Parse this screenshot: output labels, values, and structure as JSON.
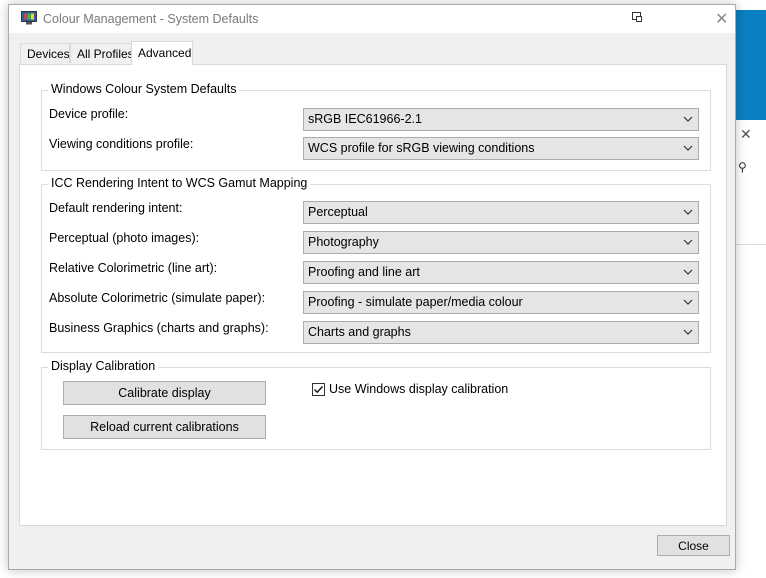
{
  "window": {
    "title": "Colour Management - System Defaults",
    "close_glyph": "✕"
  },
  "tabs": [
    {
      "label": "Devices"
    },
    {
      "label": "All Profiles"
    },
    {
      "label": "Advanced",
      "active": true
    }
  ],
  "wcs_defaults": {
    "title": "Windows Colour System Defaults",
    "rows": [
      {
        "label": "Device profile:",
        "value": "sRGB IEC61966-2.1"
      },
      {
        "label": "Viewing conditions profile:",
        "value": "WCS profile for sRGB viewing conditions"
      }
    ]
  },
  "icc_mapping": {
    "title": "ICC Rendering Intent to WCS Gamut Mapping",
    "rows": [
      {
        "label": "Default rendering intent:",
        "value": "Perceptual"
      },
      {
        "label": "Perceptual (photo images):",
        "value": "Photography"
      },
      {
        "label": "Relative Colorimetric (line art):",
        "value": "Proofing and line art"
      },
      {
        "label": "Absolute Colorimetric (simulate paper):",
        "value": "Proofing - simulate paper/media colour"
      },
      {
        "label": "Business Graphics (charts and graphs):",
        "value": "Charts and graphs"
      }
    ]
  },
  "calibration": {
    "title": "Display Calibration",
    "calibrate_label": "Calibrate display",
    "reload_label": "Reload current calibrations",
    "use_windows_label": "Use Windows display calibration",
    "use_windows_checked": true
  },
  "footer": {
    "close_label": "Close"
  },
  "colors": {
    "window_bg": "#f0f0f0",
    "content_bg": "#ffffff",
    "button_bg": "#e1e1e1",
    "background_app_accent": "#0a7fc2"
  }
}
